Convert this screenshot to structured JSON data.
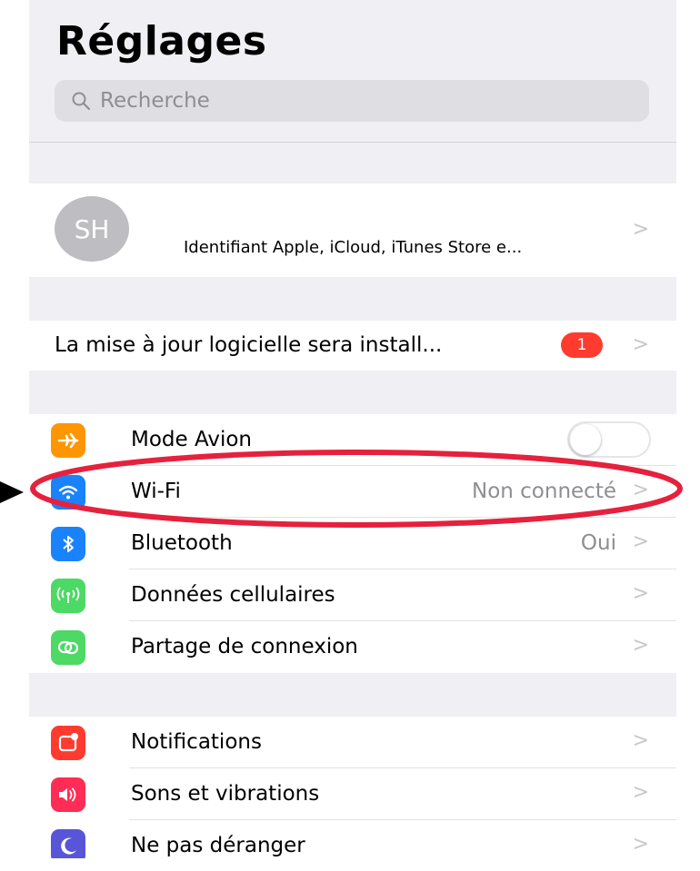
{
  "header": {
    "title": "Réglages"
  },
  "search": {
    "placeholder": "Recherche"
  },
  "profile": {
    "initials": "SH",
    "subtitle": "Identifiant Apple, iCloud, iTunes Store e..."
  },
  "update": {
    "label": "La mise à jour logicielle sera install...",
    "badge": "1"
  },
  "connectivity": [
    {
      "label": "Mode Avion",
      "icon": "airplane-icon",
      "color": "#ff9500",
      "toggle": false
    },
    {
      "label": "Wi-Fi",
      "icon": "wifi-icon",
      "color": "#1a82fb",
      "value": "Non connecté"
    },
    {
      "label": "Bluetooth",
      "icon": "bluetooth-icon",
      "color": "#1a82fb",
      "value": "Oui"
    },
    {
      "label": "Données cellulaires",
      "icon": "antenna-icon",
      "color": "#4cd964"
    },
    {
      "label": "Partage de connexion",
      "icon": "link-icon",
      "color": "#4cd964"
    }
  ],
  "general": [
    {
      "label": "Notifications",
      "icon": "notifications-icon",
      "color": "#ff3b30"
    },
    {
      "label": "Sons et vibrations",
      "icon": "speaker-icon",
      "color": "#ff2d55"
    },
    {
      "label": "Ne pas déranger",
      "icon": "moon-icon",
      "color": "#5856d6"
    }
  ],
  "annotation": {
    "color": "#e5213d"
  }
}
